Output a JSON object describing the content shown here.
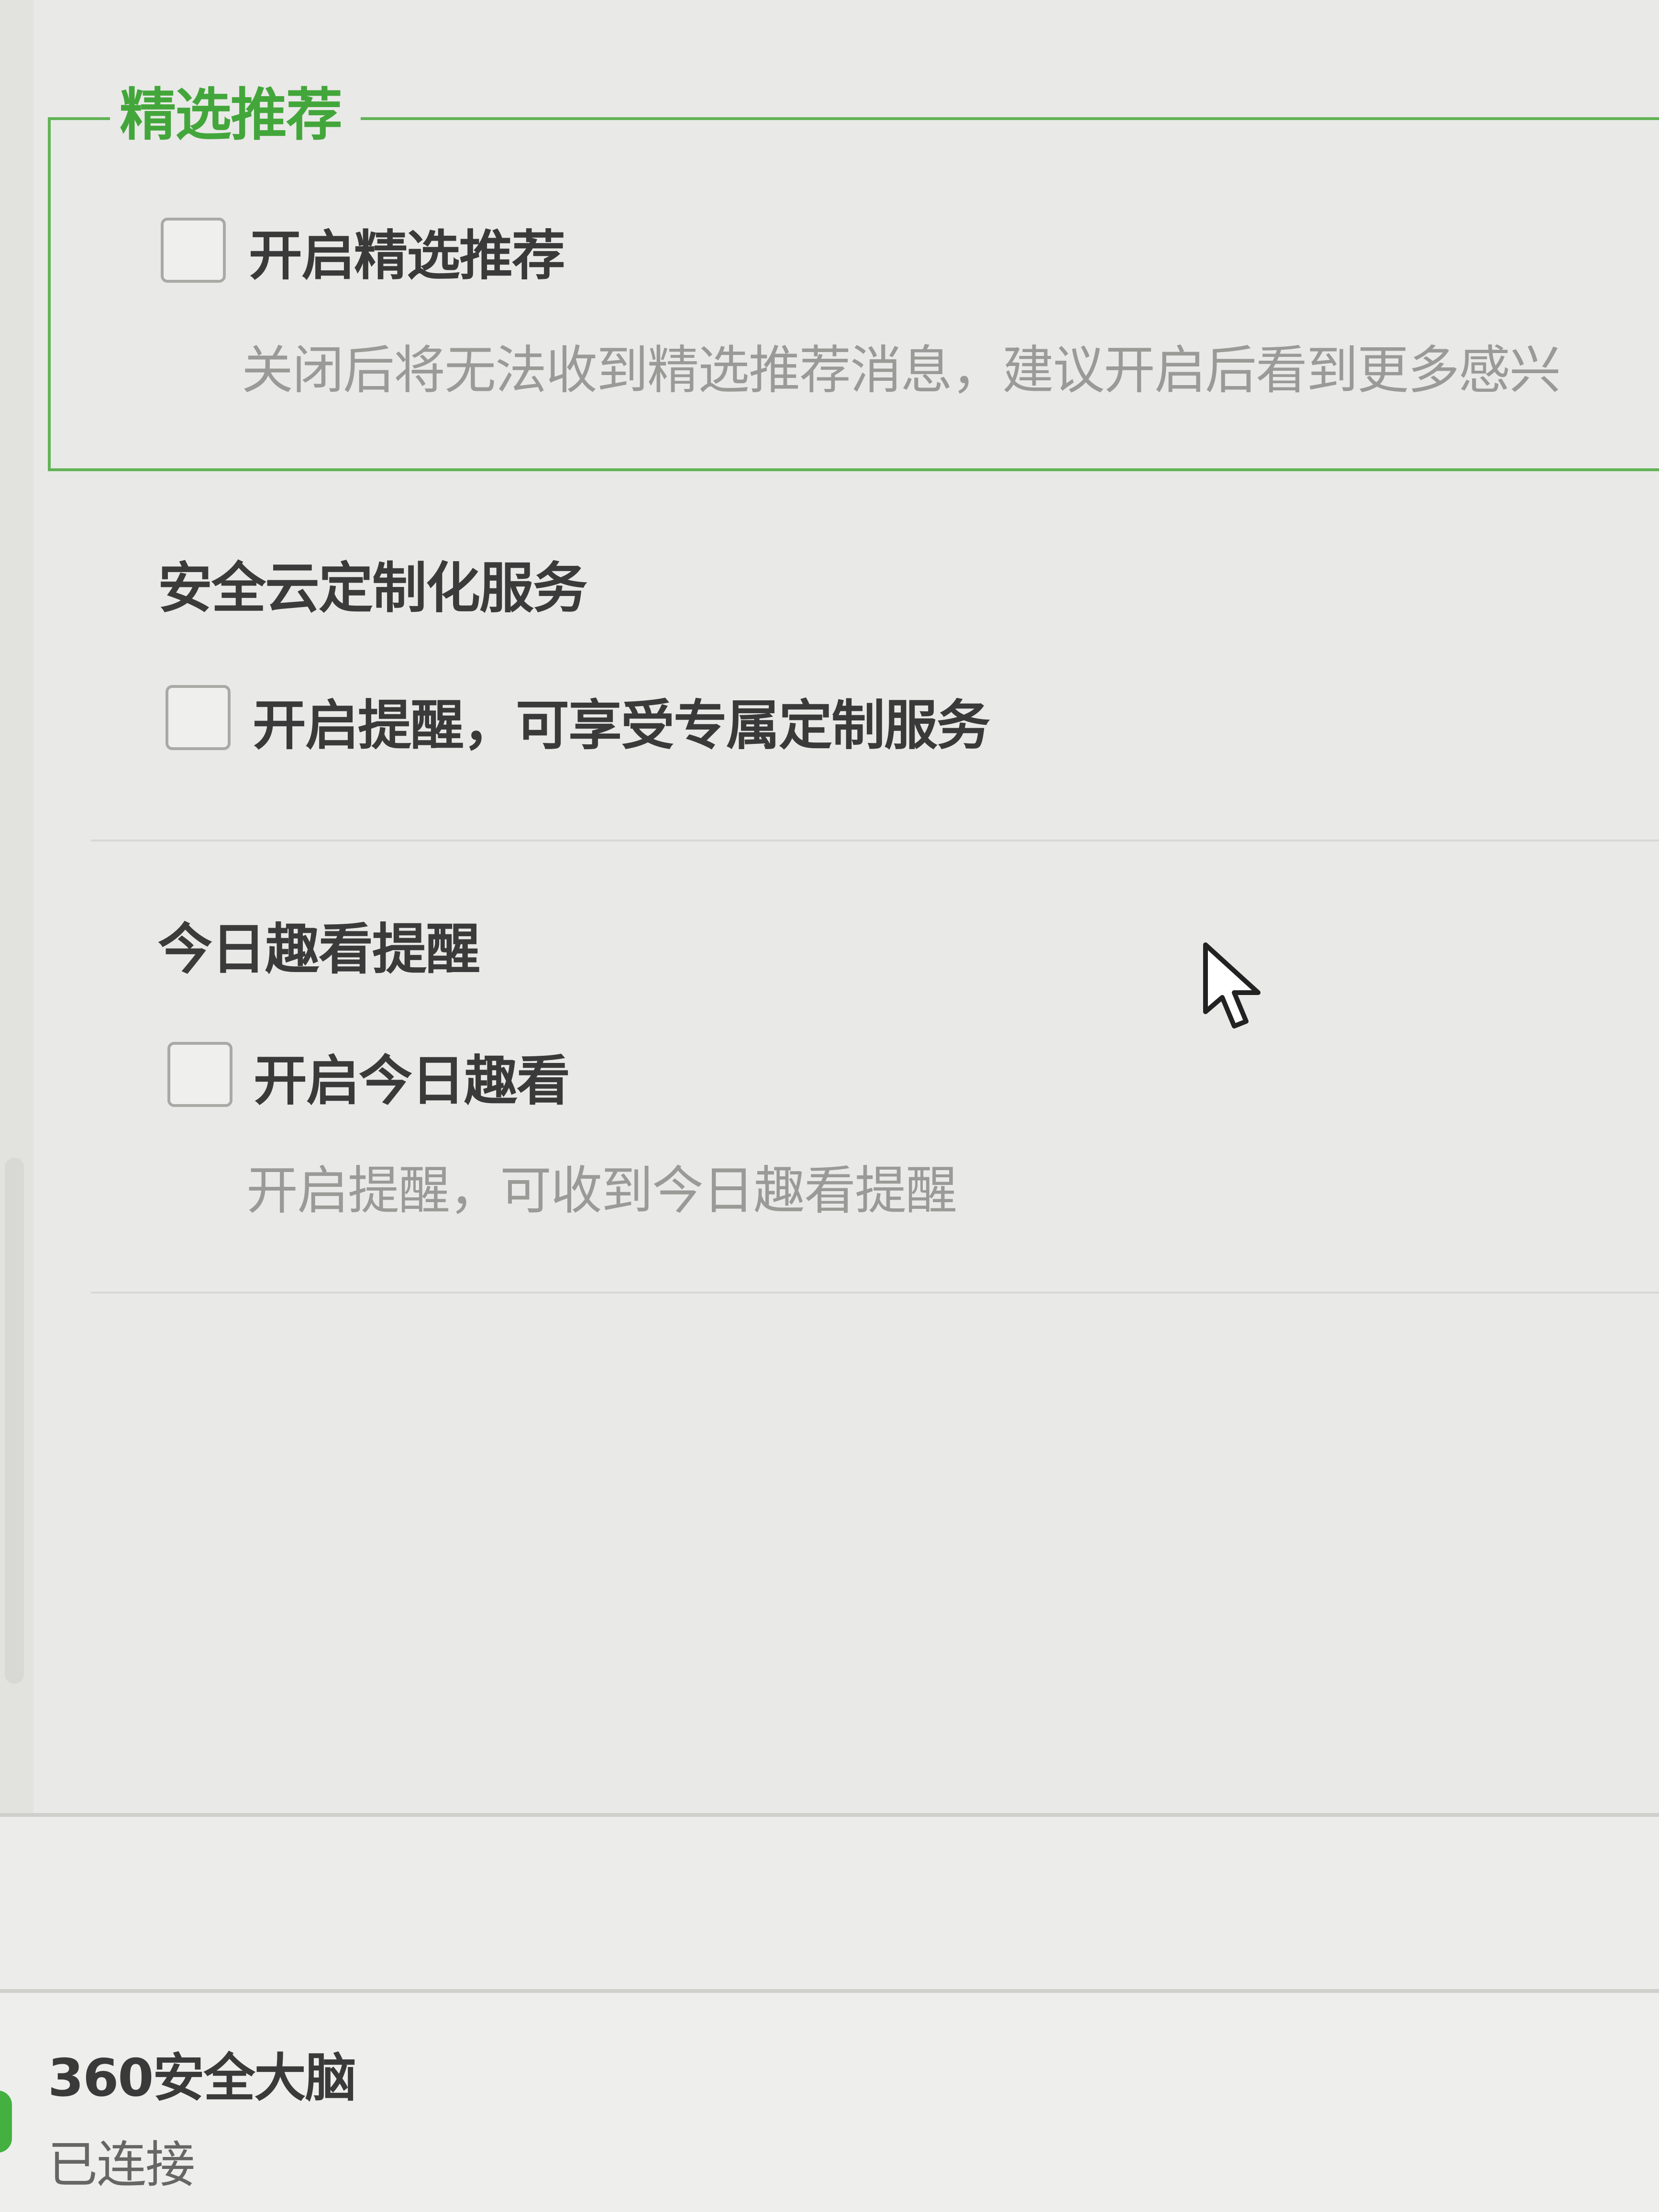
{
  "featured": {
    "group_title": "精选推荐",
    "checkbox_label": "开启精选推荐",
    "checked": false,
    "description": "关闭后将无法收到精选推荐消息，建议开启后看到更多感兴"
  },
  "cloud_service": {
    "section_title": "安全云定制化服务",
    "checkbox_label": "开启提醒，可享受专属定制服务",
    "checked": false
  },
  "daily": {
    "section_title": "今日趣看提醒",
    "checkbox_label": "开启今日趣看",
    "checked": false,
    "description": "开启提醒，可收到今日趣看提醒"
  },
  "status": {
    "title": "360安全大脑",
    "state": "已连接",
    "indicator_color": "#43b040"
  },
  "colors": {
    "accent_green": "#43a63b",
    "group_border": "#62b357"
  },
  "icons": {
    "cursor": "mouse-pointer-icon"
  }
}
